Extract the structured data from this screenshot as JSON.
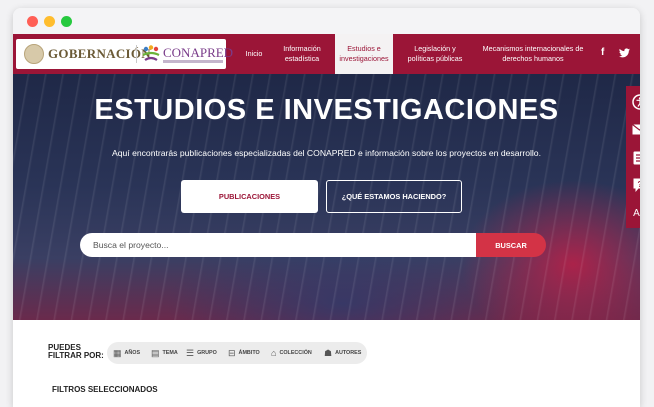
{
  "navbar": {
    "logo_gobernacion": "GOBERNACIÓN",
    "logo_conapred": "CONAPRED",
    "items": [
      {
        "label": "Inicio"
      },
      {
        "label": "Información estadística"
      },
      {
        "label": "Estudios e investigaciones",
        "active": true
      },
      {
        "label": "Legislación y políticas públicas"
      },
      {
        "label": "Mecanismos internacionales de derechos humanos"
      }
    ],
    "social": {
      "facebook": "f",
      "twitter": "🐦"
    }
  },
  "hero": {
    "title": "ESTUDIOS E INVESTIGACIONES",
    "description": "Aquí encontrarás publicaciones especializadas del CONAPRED e información sobre los proyectos en desarrollo.",
    "btn_publicaciones": "PUBLICACIONES",
    "btn_que_hacemos": "¿QUÉ ESTAMOS HACIENDO?"
  },
  "search": {
    "placeholder": "Busca el proyecto...",
    "value": "",
    "button_label": "BUSCAR"
  },
  "accessibility_toolbar": {
    "items": [
      "accessibility-icon",
      "mail-icon",
      "form-icon",
      "question-icon",
      "az-icon"
    ],
    "az_label": "AZ"
  },
  "filters": {
    "label_line1": "PUEDES",
    "label_line2": "FILTRAR POR:",
    "chips": [
      {
        "label": "AÑOS",
        "icon": "calendar-icon"
      },
      {
        "label": "TEMA",
        "icon": "topic-icon"
      },
      {
        "label": "GRUPO",
        "icon": "list-icon"
      },
      {
        "label": "ÁMBITO",
        "icon": "scope-icon"
      },
      {
        "label": "COLECCIÓN",
        "icon": "collection-icon"
      },
      {
        "label": "AUTORES",
        "icon": "authors-icon"
      }
    ],
    "selected_title": "FILTROS SELECCIONADOS"
  },
  "colors": {
    "brand": "#9b1537",
    "search_button": "#d33346"
  }
}
